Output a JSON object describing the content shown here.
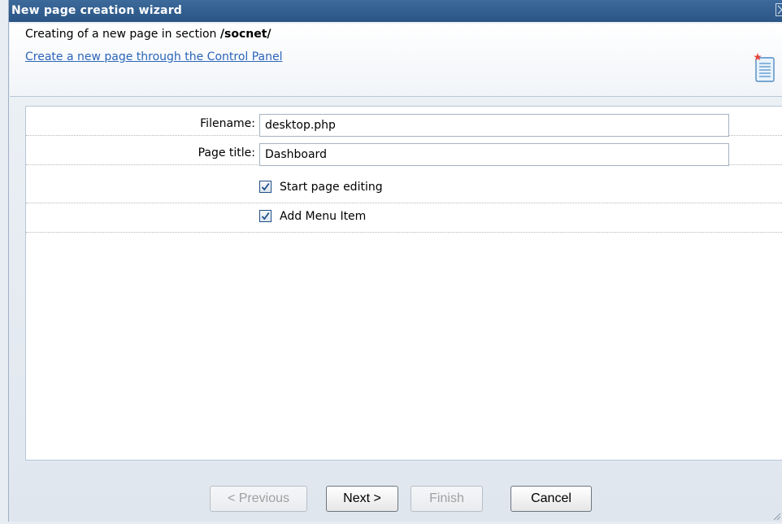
{
  "window": {
    "title": "New page creation wizard"
  },
  "header": {
    "line_prefix": "Creating of a new page in section ",
    "section": "/socnet/",
    "link_text": "Create a new page through the Control Panel"
  },
  "form": {
    "filename_label": "Filename:",
    "filename_value": "desktop.php",
    "page_title_label": "Page title:",
    "page_title_value": "Dashboard",
    "start_editing_label": "Start page editing",
    "start_editing_checked": true,
    "add_menu_label": "Add Menu Item",
    "add_menu_checked": true
  },
  "footer": {
    "previous_label": "< Previous",
    "next_label": "Next >",
    "finish_label": "Finish",
    "cancel_label": "Cancel"
  },
  "colors": {
    "titlebar": "#2f5c8e",
    "link": "#2b65b8"
  }
}
